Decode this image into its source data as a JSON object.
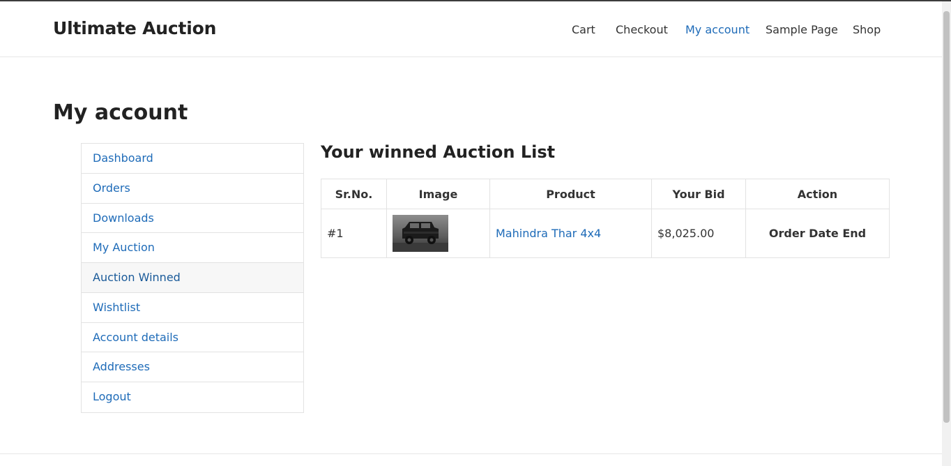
{
  "site": {
    "title": "Ultimate Auction"
  },
  "nav": {
    "items": [
      {
        "label": "Cart"
      },
      {
        "label": "Checkout"
      },
      {
        "label": "My account"
      },
      {
        "label": "Sample Page"
      },
      {
        "label": "Shop"
      }
    ]
  },
  "page": {
    "title": "My account"
  },
  "account_nav": {
    "items": [
      {
        "label": "Dashboard"
      },
      {
        "label": "Orders"
      },
      {
        "label": "Downloads"
      },
      {
        "label": "My Auction"
      },
      {
        "label": "Auction Winned"
      },
      {
        "label": "Wishtlist"
      },
      {
        "label": "Account details"
      },
      {
        "label": "Addresses"
      },
      {
        "label": "Logout"
      }
    ]
  },
  "content": {
    "heading": "Your winned Auction List",
    "table": {
      "headers": [
        "Sr.No.",
        "Image",
        "Product",
        "Your Bid",
        "Action"
      ],
      "rows": [
        {
          "sr": "#1",
          "product": "Mahindra Thar 4x4",
          "bid": "$8,025.00",
          "action": "Order Date End"
        }
      ]
    }
  },
  "colors": {
    "link": "#1e6bb8",
    "text": "#222222",
    "border": "#e2e2e2"
  }
}
